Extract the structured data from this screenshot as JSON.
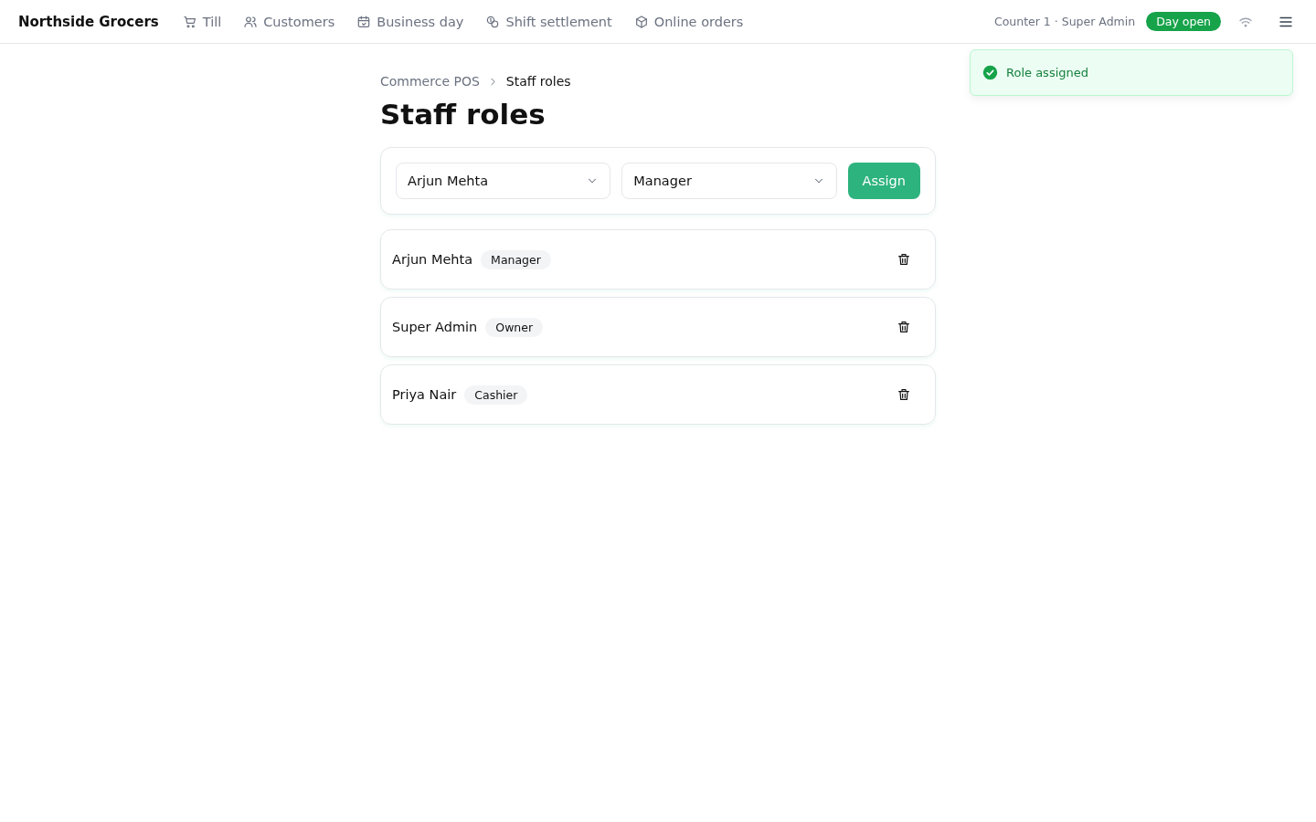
{
  "header": {
    "brand": "Northside Grocers",
    "nav": [
      {
        "label": "Till"
      },
      {
        "label": "Customers"
      },
      {
        "label": "Business day"
      },
      {
        "label": "Shift settlement"
      },
      {
        "label": "Online orders"
      }
    ],
    "session": "Counter 1 · Super Admin",
    "day_status": "Day open"
  },
  "toast": {
    "message": "Role assigned"
  },
  "breadcrumb": [
    "Commerce POS",
    "Staff roles"
  ],
  "title": "Staff roles",
  "assign_form": {
    "staff_value": "Arjun Mehta",
    "role_value": "Manager",
    "button": "Assign"
  },
  "staff": [
    {
      "name": "Arjun Mehta",
      "role": "Manager"
    },
    {
      "name": "Super Admin",
      "role": "Owner"
    },
    {
      "name": "Priya Nair",
      "role": "Cashier"
    }
  ]
}
